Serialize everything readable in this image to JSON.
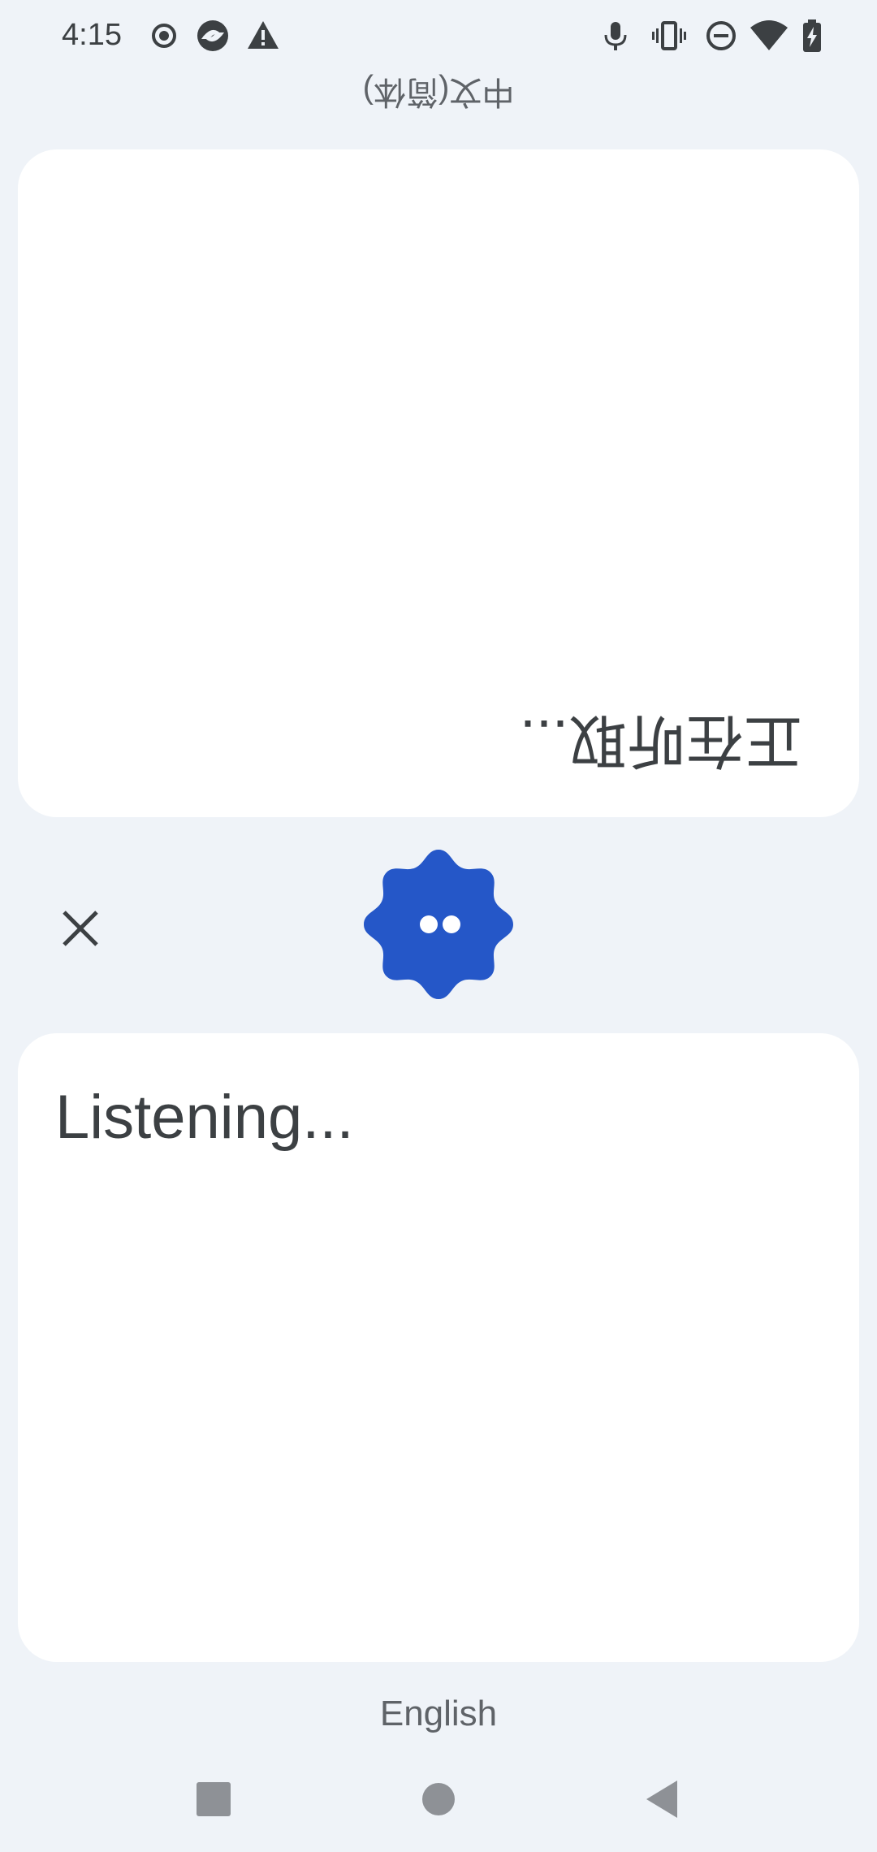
{
  "status_bar": {
    "time": "4:15",
    "left_icons": [
      "record-icon",
      "app-icon",
      "warning-icon"
    ],
    "right_icons": [
      "mic-icon",
      "vibrate-icon",
      "dnd-icon",
      "wifi-icon",
      "battery-charging-icon"
    ]
  },
  "top": {
    "language": "中文(简体)",
    "listening_text": "正在听取..."
  },
  "controls": {
    "close_icon": "close-icon",
    "mic_badge_icon": "mic-badge-icon",
    "accent_color": "#2557c8"
  },
  "bottom": {
    "listening_text": "Listening...",
    "language": "English"
  },
  "nav": {
    "buttons": [
      "recents-button",
      "home-button",
      "back-button"
    ]
  }
}
